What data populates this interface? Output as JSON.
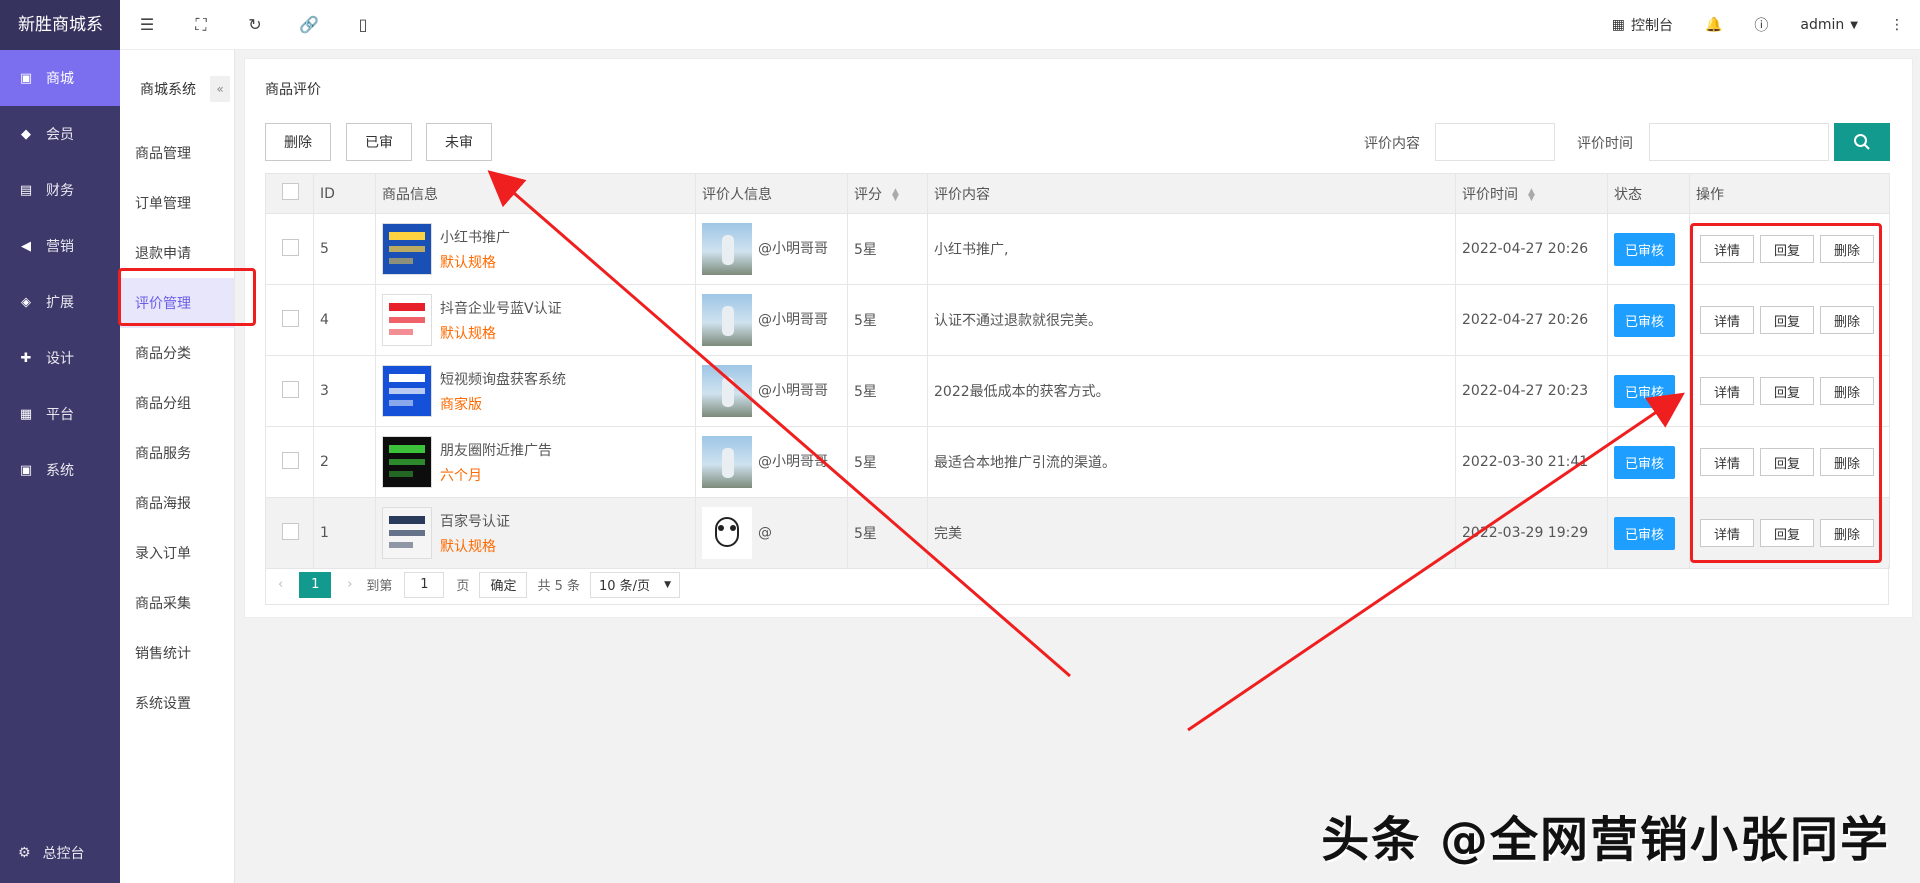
{
  "brand": "新胜商城系",
  "main_nav": [
    {
      "label": "商城",
      "icon": "shop-icon",
      "active": true
    },
    {
      "label": "会员",
      "icon": "member-icon"
    },
    {
      "label": "财务",
      "icon": "wallet-icon"
    },
    {
      "label": "营销",
      "icon": "megaphone-icon"
    },
    {
      "label": "扩展",
      "icon": "cube-icon"
    },
    {
      "label": "设计",
      "icon": "puzzle-icon"
    },
    {
      "label": "平台",
      "icon": "grid-icon"
    },
    {
      "label": "系统",
      "icon": "monitor-icon"
    }
  ],
  "bottom_nav": {
    "label": "总控台"
  },
  "sub_nav": {
    "title": "商城系统",
    "items": [
      "商品管理",
      "订单管理",
      "退款申请",
      "评价管理",
      "商品分类",
      "商品分组",
      "商品服务",
      "商品海报",
      "录入订单",
      "商品采集",
      "销售统计",
      "系统设置"
    ],
    "active_index": 3
  },
  "topbar": {
    "console_label": "控制台",
    "user": "admin"
  },
  "page": {
    "title": "商品评价",
    "buttons": {
      "delete": "删除",
      "approved": "已审",
      "unapproved": "未审"
    },
    "filter_content_label": "评价内容",
    "filter_time_label": "评价时间"
  },
  "table": {
    "headers": [
      "ID",
      "商品信息",
      "评价人信息",
      "评分",
      "评价内容",
      "评价时间",
      "状态",
      "操作"
    ],
    "rows": [
      {
        "id": "5",
        "product": "小红书推广",
        "spec": "默认规格",
        "reviewer": "@小明哥哥",
        "score": "5星",
        "content": "小红书推广,",
        "time": "2022-04-27 20:26",
        "status": "已审核"
      },
      {
        "id": "4",
        "product": "抖音企业号蓝V认证",
        "spec": "默认规格",
        "reviewer": "@小明哥哥",
        "score": "5星",
        "content": "认证不通过退款就很完美。",
        "time": "2022-04-27 20:26",
        "status": "已审核"
      },
      {
        "id": "3",
        "product": "短视频询盘获客系统",
        "spec": "商家版",
        "reviewer": "@小明哥哥",
        "score": "5星",
        "content": "2022最低成本的获客方式。",
        "time": "2022-04-27 20:23",
        "status": "已审核"
      },
      {
        "id": "2",
        "product": "朋友圈附近推广告",
        "spec": "六个月",
        "reviewer": "@小明哥哥",
        "score": "5星",
        "content": "最适合本地推广引流的渠道。",
        "time": "2022-03-30 21:41",
        "status": "已审核"
      },
      {
        "id": "1",
        "product": "百家号认证",
        "spec": "默认规格",
        "reviewer": "@",
        "score": "5星",
        "content": "完美",
        "time": "2022-03-29 19:29",
        "status": "已审核"
      }
    ],
    "ops": {
      "detail": "详情",
      "reply": "回复",
      "delete": "删除"
    }
  },
  "pager": {
    "current": "1",
    "goto_label": "到第",
    "goto_value": "1",
    "page_unit": "页",
    "confirm": "确定",
    "total": "共 5 条",
    "per_page": "10 条/页"
  },
  "watermark": "头条 @全网营销小张同学",
  "colors": {
    "sidebar": "#3d3a6b",
    "active_nav": "#7b6ff0",
    "teal": "#139a8f",
    "status_blue": "#1e9fff",
    "spec_orange": "#ff6a00",
    "annotation_red": "#f01f1f"
  }
}
